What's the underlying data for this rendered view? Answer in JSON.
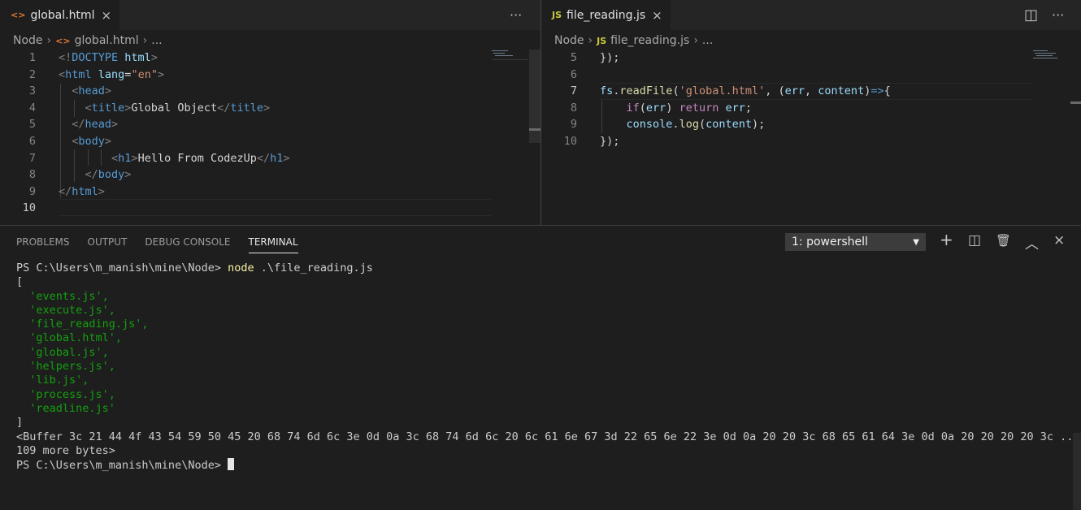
{
  "left_editor": {
    "tab": {
      "icon": "<>",
      "label": "global.html",
      "close": "×"
    },
    "more_actions": "···",
    "breadcrumb": {
      "root": "Node",
      "file_icon": "<>",
      "file": "global.html",
      "tail": "..."
    },
    "lines": [
      {
        "num": "1",
        "tokens": [
          {
            "t": "<!",
            "c": "t-punc"
          },
          {
            "t": "DOCTYPE ",
            "c": "t-tag"
          },
          {
            "t": "html",
            "c": "t-attr"
          },
          {
            "t": ">",
            "c": "t-punc"
          }
        ]
      },
      {
        "num": "2",
        "tokens": [
          {
            "t": "<",
            "c": "t-punc"
          },
          {
            "t": "html ",
            "c": "t-tag"
          },
          {
            "t": "lang",
            "c": "t-attr"
          },
          {
            "t": "=",
            "c": "t-txt"
          },
          {
            "t": "\"en\"",
            "c": "t-str"
          },
          {
            "t": ">",
            "c": "t-punc"
          }
        ]
      },
      {
        "num": "3",
        "tokens": [
          {
            "t": "  <",
            "c": "t-punc"
          },
          {
            "t": "head",
            "c": "t-tag"
          },
          {
            "t": ">",
            "c": "t-punc"
          }
        ]
      },
      {
        "num": "4",
        "tokens": [
          {
            "t": "    <",
            "c": "t-punc"
          },
          {
            "t": "title",
            "c": "t-tag"
          },
          {
            "t": ">",
            "c": "t-punc"
          },
          {
            "t": "Global Object",
            "c": "t-txt"
          },
          {
            "t": "</",
            "c": "t-punc"
          },
          {
            "t": "title",
            "c": "t-tag"
          },
          {
            "t": ">",
            "c": "t-punc"
          }
        ]
      },
      {
        "num": "5",
        "tokens": [
          {
            "t": "  </",
            "c": "t-punc"
          },
          {
            "t": "head",
            "c": "t-tag"
          },
          {
            "t": ">",
            "c": "t-punc"
          }
        ]
      },
      {
        "num": "6",
        "tokens": [
          {
            "t": "  <",
            "c": "t-punc"
          },
          {
            "t": "body",
            "c": "t-tag"
          },
          {
            "t": ">",
            "c": "t-punc"
          }
        ]
      },
      {
        "num": "7",
        "tokens": [
          {
            "t": "        <",
            "c": "t-punc"
          },
          {
            "t": "h1",
            "c": "t-tag"
          },
          {
            "t": ">",
            "c": "t-punc"
          },
          {
            "t": "Hello From CodezUp",
            "c": "t-txt"
          },
          {
            "t": "</",
            "c": "t-punc"
          },
          {
            "t": "h1",
            "c": "t-tag"
          },
          {
            "t": ">",
            "c": "t-punc"
          }
        ]
      },
      {
        "num": "8",
        "tokens": [
          {
            "t": "    </",
            "c": "t-punc"
          },
          {
            "t": "body",
            "c": "t-tag"
          },
          {
            "t": ">",
            "c": "t-punc"
          }
        ]
      },
      {
        "num": "9",
        "tokens": [
          {
            "t": "</",
            "c": "t-punc"
          },
          {
            "t": "html",
            "c": "t-tag"
          },
          {
            "t": ">",
            "c": "t-punc"
          }
        ]
      },
      {
        "num": "10",
        "tokens": []
      }
    ],
    "current_line": "10"
  },
  "right_editor": {
    "tab": {
      "icon": "JS",
      "label": "file_reading.js",
      "close": "×"
    },
    "split_icon": "◫",
    "more_actions": "···",
    "breadcrumb": {
      "root": "Node",
      "file_icon": "JS",
      "file": "file_reading.js",
      "tail": "..."
    },
    "lines": [
      {
        "num": "5",
        "tokens": [
          {
            "t": "});",
            "c": "t-txt"
          }
        ]
      },
      {
        "num": "6",
        "tokens": []
      },
      {
        "num": "7",
        "tokens": [
          {
            "t": "fs",
            "c": "t-var"
          },
          {
            "t": ".",
            "c": "t-txt"
          },
          {
            "t": "readFile",
            "c": "t-fn"
          },
          {
            "t": "(",
            "c": "t-txt"
          },
          {
            "t": "'global.html'",
            "c": "t-str"
          },
          {
            "t": ", (",
            "c": "t-txt"
          },
          {
            "t": "err",
            "c": "t-var"
          },
          {
            "t": ", ",
            "c": "t-txt"
          },
          {
            "t": "content",
            "c": "t-var"
          },
          {
            "t": ")",
            "c": "t-txt"
          },
          {
            "t": "=>",
            "c": "t-op"
          },
          {
            "t": "{",
            "c": "t-txt"
          }
        ]
      },
      {
        "num": "8",
        "tokens": [
          {
            "t": "    ",
            "c": "t-txt"
          },
          {
            "t": "if",
            "c": "t-kw"
          },
          {
            "t": "(",
            "c": "t-txt"
          },
          {
            "t": "err",
            "c": "t-var"
          },
          {
            "t": ") ",
            "c": "t-txt"
          },
          {
            "t": "return",
            "c": "t-kw"
          },
          {
            "t": " ",
            "c": "t-txt"
          },
          {
            "t": "err",
            "c": "t-var"
          },
          {
            "t": ";",
            "c": "t-txt"
          }
        ]
      },
      {
        "num": "9",
        "tokens": [
          {
            "t": "    ",
            "c": "t-txt"
          },
          {
            "t": "console",
            "c": "t-var"
          },
          {
            "t": ".",
            "c": "t-txt"
          },
          {
            "t": "log",
            "c": "t-fn"
          },
          {
            "t": "(",
            "c": "t-txt"
          },
          {
            "t": "content",
            "c": "t-var"
          },
          {
            "t": ");",
            "c": "t-txt"
          }
        ]
      },
      {
        "num": "10",
        "tokens": [
          {
            "t": "});",
            "c": "t-txt"
          }
        ]
      }
    ],
    "current_line": "7"
  },
  "panel": {
    "tabs": [
      "PROBLEMS",
      "OUTPUT",
      "DEBUG CONSOLE",
      "TERMINAL"
    ],
    "active_tab": "TERMINAL",
    "terminal_select": "1: powershell",
    "actions": {
      "new": "+",
      "split": "◫",
      "kill": "🗑",
      "maximize": "︿",
      "close": "×"
    }
  },
  "terminal": {
    "prompt": "PS C:\\Users\\m_manish\\mine\\Node> ",
    "command": "node",
    "command_arg": " .\\file_reading.js",
    "open_bracket": "[",
    "files": [
      "  'events.js',",
      "  'execute.js',",
      "  'file_reading.js',",
      "  'global.html',",
      "  'global.js',",
      "  'helpers.js',",
      "  'lib.js',",
      "  'process.js',",
      "  'readline.js'"
    ],
    "close_bracket": "]",
    "buffer_line1": "<Buffer 3c 21 44 4f 43 54 59 50 45 20 68 74 6d 6c 3e 0d 0a 3c 68 74 6d 6c 20 6c 61 6e 67 3d 22 65 6e 22 3e 0d 0a 20 20 3c 68 65 61 64 3e 0d 0a 20 20 20 20 3c ...",
    "buffer_line2": "109 more bytes>",
    "final_prompt": "PS C:\\Users\\m_manish\\mine\\Node> "
  },
  "colors": {
    "html_icon": "#e37933",
    "js_icon": "#cbcb41",
    "terminal_green": "#13a10e",
    "terminal_yellow": "#f9f1a5"
  }
}
